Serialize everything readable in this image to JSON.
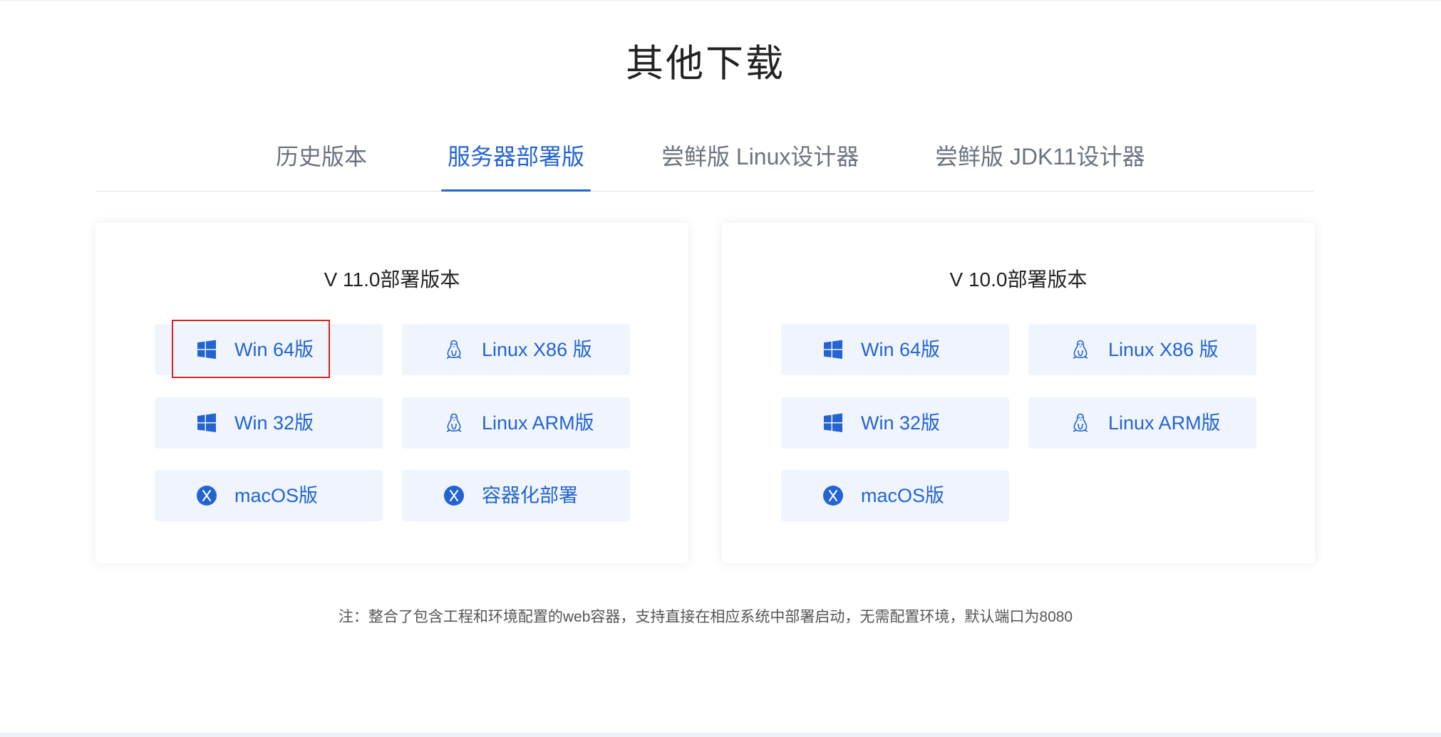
{
  "page": {
    "title": "其他下载"
  },
  "tabs": [
    {
      "label": "历史版本",
      "active": false
    },
    {
      "label": "服务器部署版",
      "active": true
    },
    {
      "label": "尝鲜版 Linux设计器",
      "active": false
    },
    {
      "label": "尝鲜版 JDK11设计器",
      "active": false
    }
  ],
  "cards": [
    {
      "title": "V 11.0部署版本",
      "buttons": [
        {
          "label": "Win 64版",
          "icon": "windows-icon"
        },
        {
          "label": "Linux X86 版",
          "icon": "linux-icon"
        },
        {
          "label": "Win 32版",
          "icon": "windows-icon"
        },
        {
          "label": "Linux ARM版",
          "icon": "linux-icon"
        },
        {
          "label": "macOS版",
          "icon": "macos-icon"
        },
        {
          "label": "容器化部署",
          "icon": "container-icon"
        }
      ]
    },
    {
      "title": "V 10.0部署版本",
      "buttons": [
        {
          "label": "Win 64版",
          "icon": "windows-icon"
        },
        {
          "label": "Linux X86 版",
          "icon": "linux-icon"
        },
        {
          "label": "Win 32版",
          "icon": "windows-icon"
        },
        {
          "label": "Linux ARM版",
          "icon": "linux-icon"
        },
        {
          "label": "macOS版",
          "icon": "macos-icon"
        }
      ]
    }
  ],
  "note": "注：整合了包含工程和环境配置的web容器，支持直接在相应系统中部署启动，无需配置环境，默认端口为8080",
  "colors": {
    "accent": "#2364d2",
    "button_bg": "#f0f5fd",
    "highlight": "#e02020"
  }
}
